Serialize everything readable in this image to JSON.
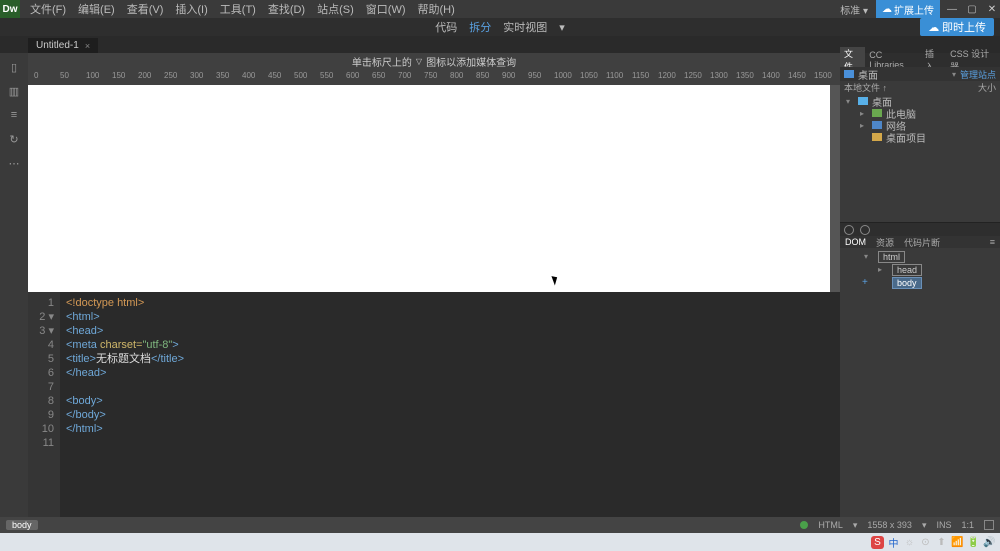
{
  "menubar": {
    "logo": "Dw",
    "items": [
      "文件(F)",
      "编辑(E)",
      "查看(V)",
      "插入(I)",
      "工具(T)",
      "查找(D)",
      "站点(S)",
      "窗口(W)",
      "帮助(H)"
    ],
    "standard": "标准 ▾",
    "sync_top": "扩展上传"
  },
  "toolbar2": {
    "code": "代码",
    "split": "拆分",
    "live": "实时视图",
    "arrow": "▾",
    "sync": "即时上传"
  },
  "tab": {
    "name": "Untitled-1",
    "close": "×"
  },
  "hint": {
    "left": "单击标尺上的",
    "tri": "▽",
    "right": "图标以添加媒体查询"
  },
  "ruler_ticks": [
    "0",
    "50",
    "100",
    "150",
    "200",
    "250",
    "300",
    "350",
    "400",
    "450",
    "500",
    "550",
    "600",
    "650",
    "700",
    "750",
    "800",
    "850",
    "900",
    "950",
    "1000",
    "1050",
    "1100",
    "1150",
    "1200",
    "1250",
    "1300",
    "1350",
    "1400",
    "1450",
    "1500"
  ],
  "code_lines": [
    {
      "n": "1",
      "html": "<span class='c-doctype'>&lt;!doctype html&gt;</span>"
    },
    {
      "n": "2",
      "fold": "▾",
      "html": "<span class='c-tag'>&lt;html&gt;</span>"
    },
    {
      "n": "3",
      "fold": "▾",
      "html": "<span class='c-tag'>&lt;head&gt;</span>"
    },
    {
      "n": "4",
      "html": "<span class='c-tag'>&lt;meta</span> <span class='c-attr'>charset=</span><span class='c-str'>\"utf-8\"</span><span class='c-tag'>&gt;</span>"
    },
    {
      "n": "5",
      "html": "<span class='c-tag'>&lt;title&gt;</span><span class='c-text'>无标题文档</span><span class='c-tag'>&lt;/title&gt;</span>"
    },
    {
      "n": "6",
      "html": "<span class='c-tag'>&lt;/head&gt;</span>"
    },
    {
      "n": "7",
      "html": ""
    },
    {
      "n": "8",
      "html": "<span class='c-tag'>&lt;body&gt;</span>"
    },
    {
      "n": "9",
      "html": "<span class='c-tag'>&lt;/body&gt;</span>"
    },
    {
      "n": "10",
      "html": "<span class='c-tag'>&lt;/html&gt;</span>"
    },
    {
      "n": "11",
      "html": ""
    }
  ],
  "files_panel": {
    "tabs": [
      "文件",
      "CC Libraries",
      "插入",
      "CSS 设计器"
    ],
    "site_label": "桌面",
    "manage": "管理站点",
    "localfiles": "本地文件 ↑",
    "size": "大小",
    "tree": [
      {
        "lvl": 1,
        "icon": "comp",
        "label": "桌面",
        "arrow": "▾"
      },
      {
        "lvl": 2,
        "icon": "disk",
        "label": "此电脑",
        "arrow": "▸"
      },
      {
        "lvl": 2,
        "icon": "net",
        "label": "网络",
        "arrow": "▸"
      },
      {
        "lvl": 2,
        "icon": "fold",
        "label": "桌面项目"
      }
    ]
  },
  "dom_panel": {
    "tabs": [
      "DOM",
      "资源",
      "代码片断"
    ],
    "nodes": [
      {
        "lvl": 1,
        "arrow": "▾",
        "tag": "html"
      },
      {
        "lvl": 2,
        "arrow": "▸",
        "tag": "head"
      },
      {
        "lvl": 2,
        "plus": "+",
        "tag": "body",
        "selected": true
      }
    ]
  },
  "status": {
    "tag": "body",
    "html": "HTML",
    "size": "1558 x 393",
    "ins": "INS",
    "ratio": "1:1"
  },
  "taskbar": {
    "ime": "S",
    "zh": "中",
    "icons": [
      "☼",
      "⊙",
      "⬆",
      "📶",
      "🔋",
      "🔊"
    ]
  }
}
